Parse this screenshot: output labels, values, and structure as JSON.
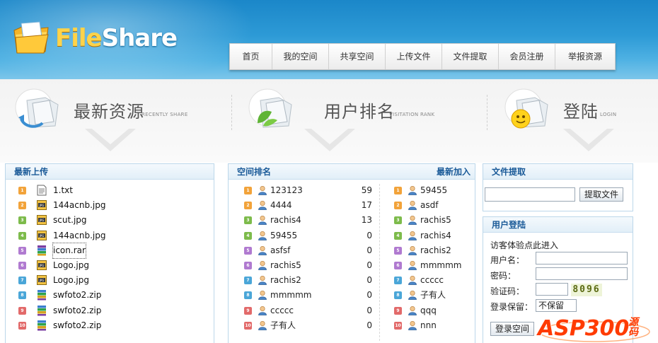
{
  "brand": {
    "part1": "File",
    "part2": "Share"
  },
  "nav": [
    "首页",
    "我的空间",
    "共享空间",
    "上传文件",
    "文件提取",
    "会员注册",
    "举报资源"
  ],
  "banner": [
    {
      "title": "最新资源",
      "subtitle": "RECENTLY SHARE"
    },
    {
      "title": "用户排名",
      "subtitle": "VISITATION RANK"
    },
    {
      "title": "登陆",
      "subtitle": "LOGIN"
    }
  ],
  "latest": {
    "header": "最新上传",
    "items": [
      {
        "n": "1",
        "name": "1.txt",
        "type": "txt"
      },
      {
        "n": "2",
        "name": "144acnb.jpg",
        "type": "jpg"
      },
      {
        "n": "3",
        "name": "scut.jpg",
        "type": "jpg"
      },
      {
        "n": "4",
        "name": "144acnb.jpg",
        "type": "jpg"
      },
      {
        "n": "5",
        "name": "icon.rar",
        "type": "rar"
      },
      {
        "n": "6",
        "name": "Logo.jpg",
        "type": "jpg"
      },
      {
        "n": "7",
        "name": "Logo.jpg",
        "type": "jpg"
      },
      {
        "n": "8",
        "name": "swfoto2.zip",
        "type": "zip"
      },
      {
        "n": "9",
        "name": "swfoto2.zip",
        "type": "zip"
      },
      {
        "n": "10",
        "name": "swfoto2.zip",
        "type": "zip"
      }
    ]
  },
  "ranking": {
    "header": "空间排名",
    "header_right": "最新加入",
    "rank": [
      {
        "n": "1",
        "name": "123123",
        "value": "59"
      },
      {
        "n": "2",
        "name": "4444",
        "value": "17"
      },
      {
        "n": "3",
        "name": "rachis4",
        "value": "13"
      },
      {
        "n": "4",
        "name": "59455",
        "value": "0"
      },
      {
        "n": "5",
        "name": "asfsf",
        "value": "0"
      },
      {
        "n": "6",
        "name": "rachis5",
        "value": "0"
      },
      {
        "n": "7",
        "name": "rachis2",
        "value": "0"
      },
      {
        "n": "8",
        "name": "mmmmm",
        "value": "0"
      },
      {
        "n": "9",
        "name": "ccccc",
        "value": "0"
      },
      {
        "n": "10",
        "name": "子有人",
        "value": "0"
      }
    ],
    "newest": [
      {
        "n": "1",
        "name": "59455"
      },
      {
        "n": "2",
        "name": "asdf"
      },
      {
        "n": "3",
        "name": "rachis5"
      },
      {
        "n": "4",
        "name": "rachis4"
      },
      {
        "n": "5",
        "name": "rachis2"
      },
      {
        "n": "6",
        "name": "mmmmm"
      },
      {
        "n": "7",
        "name": "ccccc"
      },
      {
        "n": "8",
        "name": "子有人"
      },
      {
        "n": "9",
        "name": "qqq"
      },
      {
        "n": "10",
        "name": "nnn"
      }
    ]
  },
  "extract": {
    "header": "文件提取",
    "input_value": "",
    "button": "提取文件"
  },
  "login": {
    "header": "用户登陆",
    "guest": "访客体验点此进入",
    "username_label": "用户名：",
    "password_label": "密码：",
    "captcha_label": "验证码：",
    "captcha_value": "8096",
    "remember_label": "登录保留：",
    "remember_selected": "不保留",
    "submit": "登录空间"
  },
  "watermark": {
    "text": "ASP300",
    "suffix": "源码"
  },
  "colors": {
    "header_blue": "#2d9ad6",
    "panel_title": "#1a5a98",
    "panel_border": "#bcd7ea"
  }
}
